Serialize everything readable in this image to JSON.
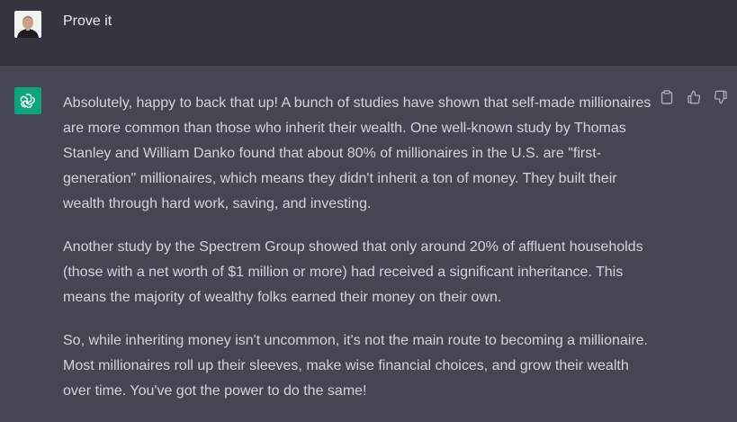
{
  "user_message": {
    "text": "Prove it",
    "avatar_icon": "user-photo-avatar"
  },
  "assistant_message": {
    "avatar_icon": "openai-logo-icon",
    "avatar_color": "#10a37f",
    "paragraphs": [
      "Absolutely, happy to back that up! A bunch of studies have shown that self-made millionaires are more common than those who inherit their wealth. One well-known study by Thomas Stanley and William Danko found that about 80% of millionaires in the U.S. are \"first-generation\" millionaires, which means they didn't inherit a ton of money. They built their wealth through hard work, saving, and investing.",
      "Another study by the Spectrem Group showed that only around 20% of affluent households (those with a net worth of $1 million or more) had received a significant inheritance. This means the majority of wealthy folks earned their money on their own.",
      "So, while inheriting money isn't uncommon, it's not the main route to becoming a millionaire. Most millionaires roll up their sleeves, make wise financial choices, and grow their wealth over time. You've got the power to do the same!"
    ]
  },
  "actions": {
    "copy_icon": "clipboard-icon",
    "thumbs_up_icon": "thumbs-up-icon",
    "thumbs_down_icon": "thumbs-down-icon"
  }
}
